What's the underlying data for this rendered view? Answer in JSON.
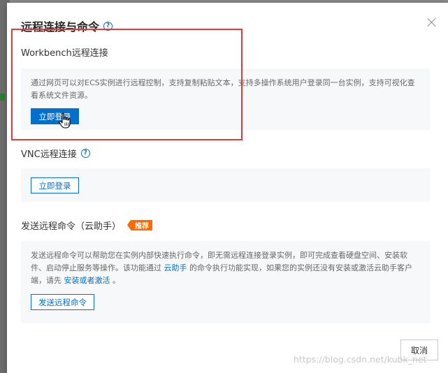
{
  "dialog": {
    "title": "远程连接与命令",
    "close_label": "×"
  },
  "workbench": {
    "label": "Workbench远程连接",
    "description": "通过网页可以对ECS实例进行远程控制，支持复制粘贴文本，支持多操作系统用户登录同一台实例，支持可视化查看系统文件资源。",
    "button_label": "立即登录"
  },
  "vnc": {
    "label": "VNC远程连接",
    "button_label": "立即登录"
  },
  "cloud_assistant": {
    "label": "发送远程命令（云助手）",
    "badge": "推荐",
    "desc_part1": "发送远程命令可以帮助您在实例内部快速执行命令，即无需远程连接登录实例，即可完成查看硬盘空间、安装软件、启动停止服务等操作。该功能通过 ",
    "desc_link1": "云助手",
    "desc_part2": " 的命令执行功能实现，如果您的实例还没有安装或激活云助手客户端，请先 ",
    "desc_link2": "安装或者激活",
    "desc_part3": " 。",
    "button_label": "发送远程命令"
  },
  "footer": {
    "cancel_label": "取消"
  },
  "watermark": "https://blog.csdn.net/kubk_net",
  "colors": {
    "accent": "#0070cc",
    "badge": "#ff6a00",
    "highlight": "#e53935"
  },
  "icons": {
    "help": "help-circle-icon",
    "close": "close-icon",
    "cursor": "hand-pointer-icon"
  }
}
